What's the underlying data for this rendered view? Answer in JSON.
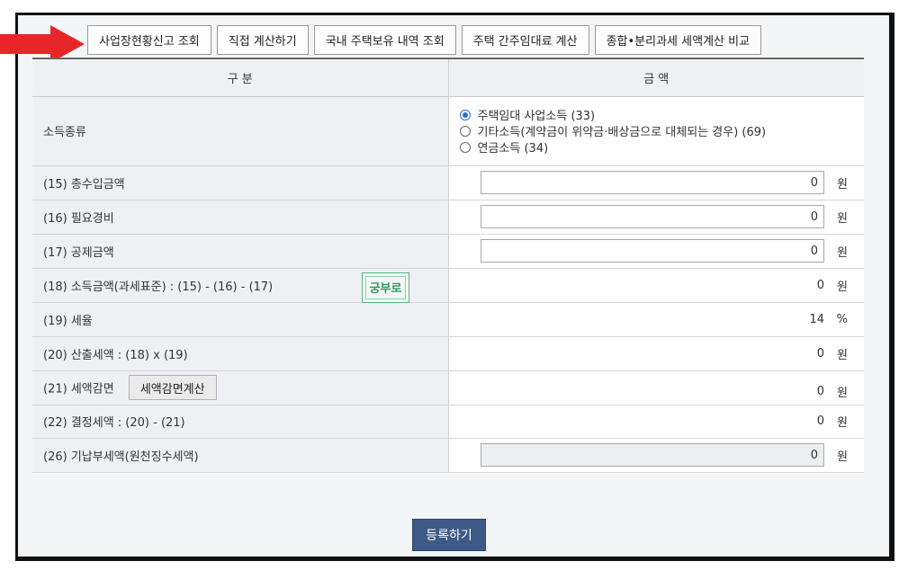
{
  "toolbar": {
    "buttons": [
      "사업장현황신고 조회",
      "직접 계산하기",
      "국내 주택보유 내역 조회",
      "주택 간주임대료 계산",
      "종합•분리과세 세액계산 비교"
    ]
  },
  "table": {
    "headers": [
      "구 분",
      "금 액"
    ],
    "income_type": {
      "label": "소득종류",
      "options": [
        {
          "label": "주택임대 사업소득 (33)",
          "selected": true
        },
        {
          "label": "기타소득(계약금이 위약금·배상금으로 대체되는 경우) (69)",
          "selected": false
        },
        {
          "label": "연금소득 (34)",
          "selected": false
        }
      ]
    },
    "rows": {
      "r15": {
        "label": "(15) 총수입금액",
        "value": "0",
        "unit": "원"
      },
      "r16": {
        "label": "(16) 필요경비",
        "value": "0",
        "unit": "원"
      },
      "r17": {
        "label": "(17) 공제금액",
        "value": "0",
        "unit": "원"
      },
      "r18": {
        "label": "(18) 소득금액(과세표준) : (15) - (16) - (17)",
        "value": "0",
        "unit": "원",
        "stamp": "궁부로"
      },
      "r19": {
        "label": "(19) 세율",
        "value": "14",
        "unit": "%"
      },
      "r20": {
        "label": "(20) 산출세액 : (18) x (19)",
        "value": "0",
        "unit": "원"
      },
      "r21": {
        "label": "(21) 세액감면",
        "button": "세액감면계산",
        "value": "0",
        "unit": "원"
      },
      "r22": {
        "label": "(22) 결정세액 : (20) - (21)",
        "value": "0",
        "unit": "원"
      },
      "r26": {
        "label": "(26) 기납부세액(원천징수세액)",
        "value": "0",
        "unit": "원"
      }
    }
  },
  "footer": {
    "register_label": "등록하기"
  },
  "colors": {
    "arrow": "#e8262a",
    "primary_button": "#3d5a86",
    "radio_selected": "#2b6fd6",
    "stamp": "#2e9a57"
  }
}
